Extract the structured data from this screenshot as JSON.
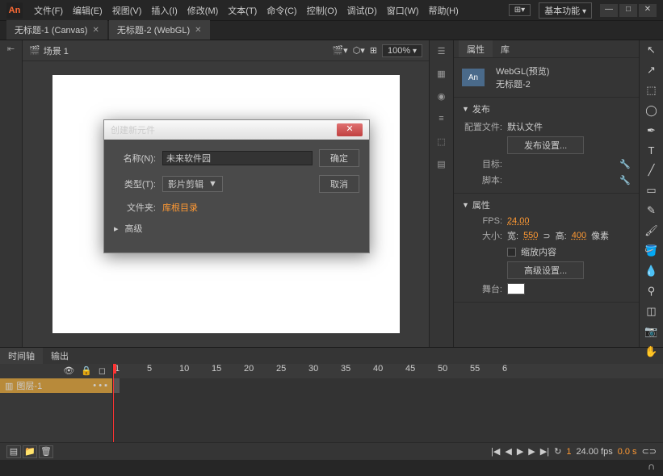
{
  "logo": "An",
  "menu": [
    "文件(F)",
    "编辑(E)",
    "视图(V)",
    "插入(I)",
    "修改(M)",
    "文本(T)",
    "命令(C)",
    "控制(O)",
    "调试(D)",
    "窗口(W)",
    "帮助(H)"
  ],
  "workspace_label": "基本功能",
  "tabs": [
    {
      "label": "无标题-1 (Canvas)",
      "active": false
    },
    {
      "label": "无标题-2 (WebGL)",
      "active": true
    }
  ],
  "scene": "场景 1",
  "zoom": "100%",
  "panel": {
    "tabs": [
      "属性",
      "库"
    ],
    "doc_type": "WebGL(预览)",
    "doc_name": "无标题-2",
    "sections": {
      "publish": {
        "title": "发布",
        "profile_label": "配置文件:",
        "profile_value": "默认文件",
        "settings_btn": "发布设置...",
        "target_label": "目标:",
        "script_label": "脚本:"
      },
      "props": {
        "title": "属性",
        "fps_label": "FPS:",
        "fps": "24.00",
        "size_label": "大小:",
        "w_label": "宽:",
        "w": "550",
        "h_label": "高:",
        "h": "400",
        "unit": "像素",
        "scale_label": "缩放内容",
        "adv_btn": "高级设置...",
        "stage_label": "舞台:"
      }
    }
  },
  "dialog": {
    "title": "创建新元件",
    "name_label": "名称(N):",
    "name_value": "未来软件园",
    "type_label": "类型(T):",
    "type_value": "影片剪辑",
    "folder_label": "文件夹:",
    "folder_value": "库根目录",
    "advanced": "高级",
    "ok": "确定",
    "cancel": "取消"
  },
  "timeline": {
    "tabs": [
      "时间轴",
      "输出"
    ],
    "frames": [
      "1",
      "5",
      "10",
      "15",
      "20",
      "25",
      "30",
      "35",
      "40",
      "45",
      "50",
      "55",
      "6"
    ],
    "layer": "图层-1",
    "fps": "24.00 fps",
    "time": "0.0 s",
    "frame": "1"
  }
}
